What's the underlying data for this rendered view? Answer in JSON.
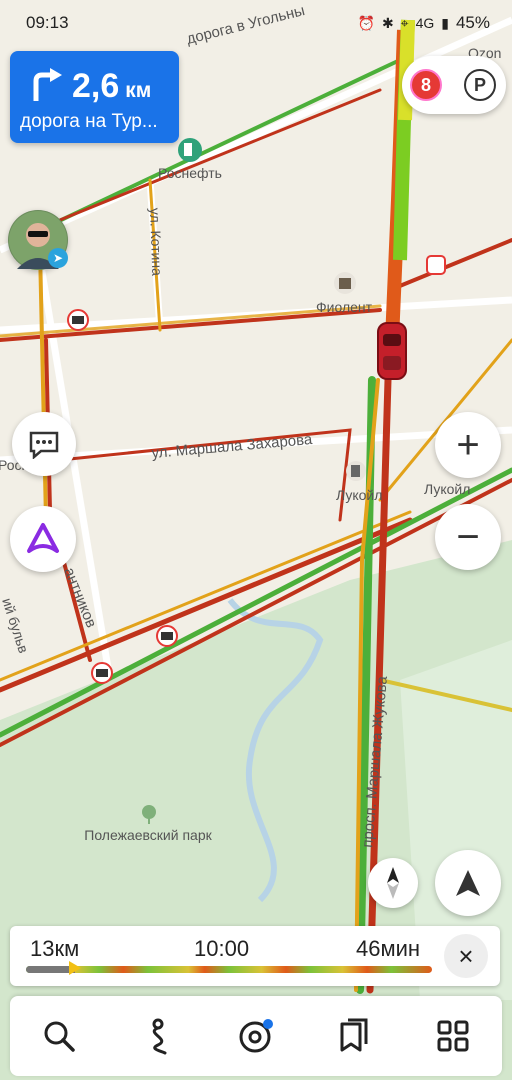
{
  "status_bar": {
    "time": "09:13",
    "network": "4G",
    "battery": "45%"
  },
  "maneuver": {
    "distance": "2,6",
    "unit": "км",
    "street": "дорога на Тур..."
  },
  "badges": {
    "events_count": "8",
    "parking": "P"
  },
  "map_labels": {
    "road_top": "дорога в Угольны",
    "rosneft_top": "Роснефть",
    "kotina": "ул. Котина",
    "fiolent": "Фиолент",
    "zakharova": "ул. Маршала Захарова",
    "rosneft_left": "Роснефть",
    "lukoil_1": "Лукойл",
    "lukoil_2": "Лукойл",
    "boulevard": "ий бульв",
    "antnikov": "антников",
    "zhukova": "просп. Маршала Жукова",
    "park": "Полежаевский парк",
    "ozon": "Ozon"
  },
  "route_summary": {
    "distance": "13км",
    "eta": "10:00",
    "duration": "46мин",
    "progress_fraction": 0.12
  },
  "controls": {
    "zoom_in": "+",
    "zoom_out": "−",
    "close": "×"
  },
  "tabs": [
    {
      "name": "search",
      "icon": "search-icon"
    },
    {
      "name": "navigation",
      "icon": "route-icon"
    },
    {
      "name": "music",
      "icon": "music-icon"
    },
    {
      "name": "bookmarks",
      "icon": "bookmarks-icon"
    },
    {
      "name": "services",
      "icon": "grid-icon"
    }
  ],
  "colors": {
    "accent": "#1a73e8",
    "traffic_green": "#4caf3a",
    "traffic_yellow": "#e2a21a",
    "traffic_red": "#c0331b",
    "park": "#d3e6cc"
  }
}
